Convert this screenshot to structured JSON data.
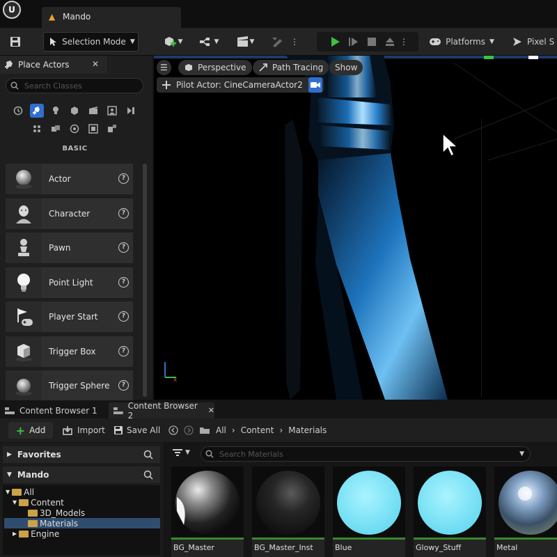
{
  "window": {
    "tab_title": "Mando"
  },
  "toolbar": {
    "selection_mode": "Selection Mode",
    "platforms": "Platforms",
    "pixel_streaming": "Pixel S"
  },
  "place_actors": {
    "tab_label": "Place Actors",
    "search_placeholder": "Search Classes",
    "category_label": "BASIC",
    "items": [
      {
        "label": "Actor",
        "icon": "sphere-icon"
      },
      {
        "label": "Character",
        "icon": "character-icon"
      },
      {
        "label": "Pawn",
        "icon": "pawn-icon"
      },
      {
        "label": "Point Light",
        "icon": "lightbulb-icon"
      },
      {
        "label": "Player Start",
        "icon": "flag-icon"
      },
      {
        "label": "Trigger Box",
        "icon": "cube-icon"
      },
      {
        "label": "Trigger Sphere",
        "icon": "sphere-icon"
      }
    ]
  },
  "viewport": {
    "perspective": "Perspective",
    "path_tracing": "Path Tracing",
    "show": "Show",
    "pilot_actor": "Pilot Actor: CineCameraActor2"
  },
  "content_browser": {
    "tabs": [
      "Content Browser 1",
      "Content Browser 2"
    ],
    "add_label": "Add",
    "import_label": "Import",
    "save_all_label": "Save All",
    "breadcrumb": [
      "All",
      "Content",
      "Materials"
    ],
    "favorites": "Favorites",
    "project": "Mando",
    "tree": {
      "all": "All",
      "content": "Content",
      "models": "3D_Models",
      "materials": "Materials",
      "engine": "Engine"
    },
    "search_placeholder": "Search Materials",
    "assets": [
      {
        "label": "BG_Master"
      },
      {
        "label": "BG_Master_Inst"
      },
      {
        "label": "Blue"
      },
      {
        "label": "Glowy_Stuff"
      },
      {
        "label": "Metal"
      }
    ]
  },
  "colors": {
    "accent_play": "#3fbf3f",
    "selection_highlight": "#2f4d6e",
    "folder": "#c9a24a",
    "asset_underline": "#3a8a2f"
  }
}
